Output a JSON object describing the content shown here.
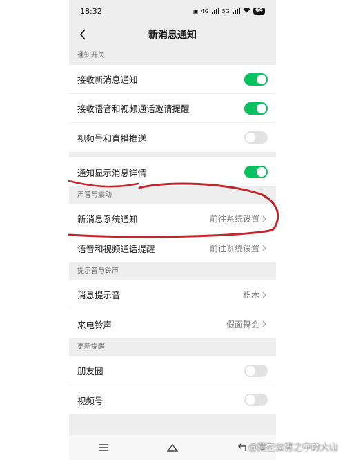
{
  "status_bar": {
    "time": "18:32",
    "net1": "4G",
    "net2": "5G",
    "battery": "99"
  },
  "header": {
    "title": "新消息通知"
  },
  "sections": {
    "notify_switch": {
      "title": "通知开关",
      "items": [
        {
          "label": "接收新消息通知",
          "state": "on"
        },
        {
          "label": "接收语音和视频通话邀请提醒",
          "state": "on"
        },
        {
          "label": "视频号和直播推送",
          "state": "off"
        }
      ]
    },
    "detail": {
      "items": [
        {
          "label": "通知显示消息详情",
          "state": "on"
        }
      ]
    },
    "sound_vibration": {
      "title": "声音与震动",
      "items": [
        {
          "label": "新消息系统通知",
          "value": "前往系统设置"
        },
        {
          "label": "语音和视频通话提醒",
          "value": "前往系统设置"
        }
      ]
    },
    "tones": {
      "title": "提示音与铃声",
      "items": [
        {
          "label": "消息提示音",
          "value": "积木"
        },
        {
          "label": "来电铃声",
          "value": "假面舞会"
        }
      ]
    },
    "update_reminder": {
      "title": "更新提醒",
      "items": [
        {
          "label": "朋友圈",
          "state": "off"
        },
        {
          "label": "视频号",
          "state": "off"
        }
      ]
    }
  },
  "watermark": "@藏在云雾之中的大山",
  "colors": {
    "accent": "#07c160",
    "page_bg": "#ededed",
    "annotation": "#c0262c"
  },
  "icons": {
    "back": "chevron-left-icon",
    "chevron": "chevron-right-icon",
    "menu": "menu-icon",
    "home": "home-icon",
    "back_nav": "back-icon"
  }
}
